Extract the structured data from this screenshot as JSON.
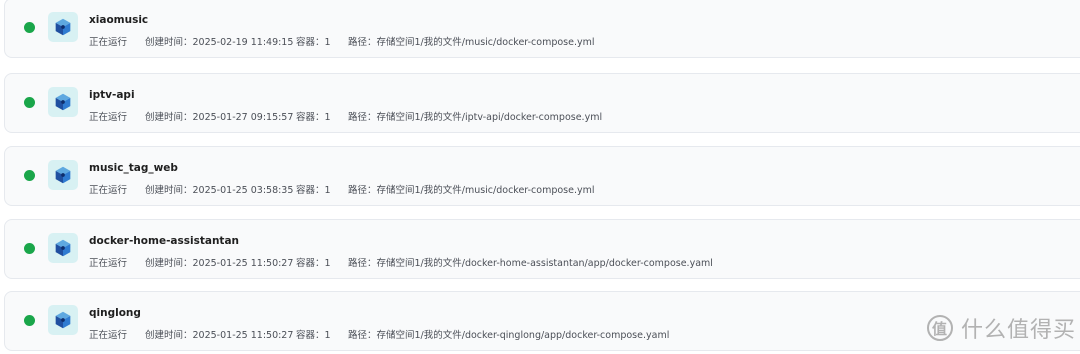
{
  "items": [
    {
      "name": "xiaomusic",
      "status": "正在运行",
      "created": "创建时间：2025-02-19 11:49:15",
      "containers": "容器：1",
      "path": "路径：存储空间1/我的文件/music/docker-compose.yml"
    },
    {
      "name": "iptv-api",
      "status": "正在运行",
      "created": "创建时间：2025-01-27 09:15:57",
      "containers": "容器：1",
      "path": "路径：存储空间1/我的文件/iptv-api/docker-compose.yml"
    },
    {
      "name": "music_tag_web",
      "status": "正在运行",
      "created": "创建时间：2025-01-25 03:58:35",
      "containers": "容器：1",
      "path": "路径：存储空间1/我的文件/music/docker-compose.yml"
    },
    {
      "name": "docker-home-assistantan",
      "status": "正在运行",
      "created": "创建时间：2025-01-25 11:50:27",
      "containers": "容器：1",
      "path": "路径：存储空间1/我的文件/docker-home-assistantan/app/docker-compose.yaml"
    },
    {
      "name": "qinglong",
      "status": "正在运行",
      "created": "创建时间：2025-01-25 11:50:27",
      "containers": "容器：1",
      "path": "路径：存储空间1/我的文件/docker-qinglong/app/docker-compose.yaml"
    }
  ],
  "watermark": {
    "logo": "值",
    "text": "什么值得买"
  },
  "colors": {
    "running": "#1aa64a",
    "card_bg": "#f9fafb",
    "icon_bg": "#d8f1f3"
  }
}
